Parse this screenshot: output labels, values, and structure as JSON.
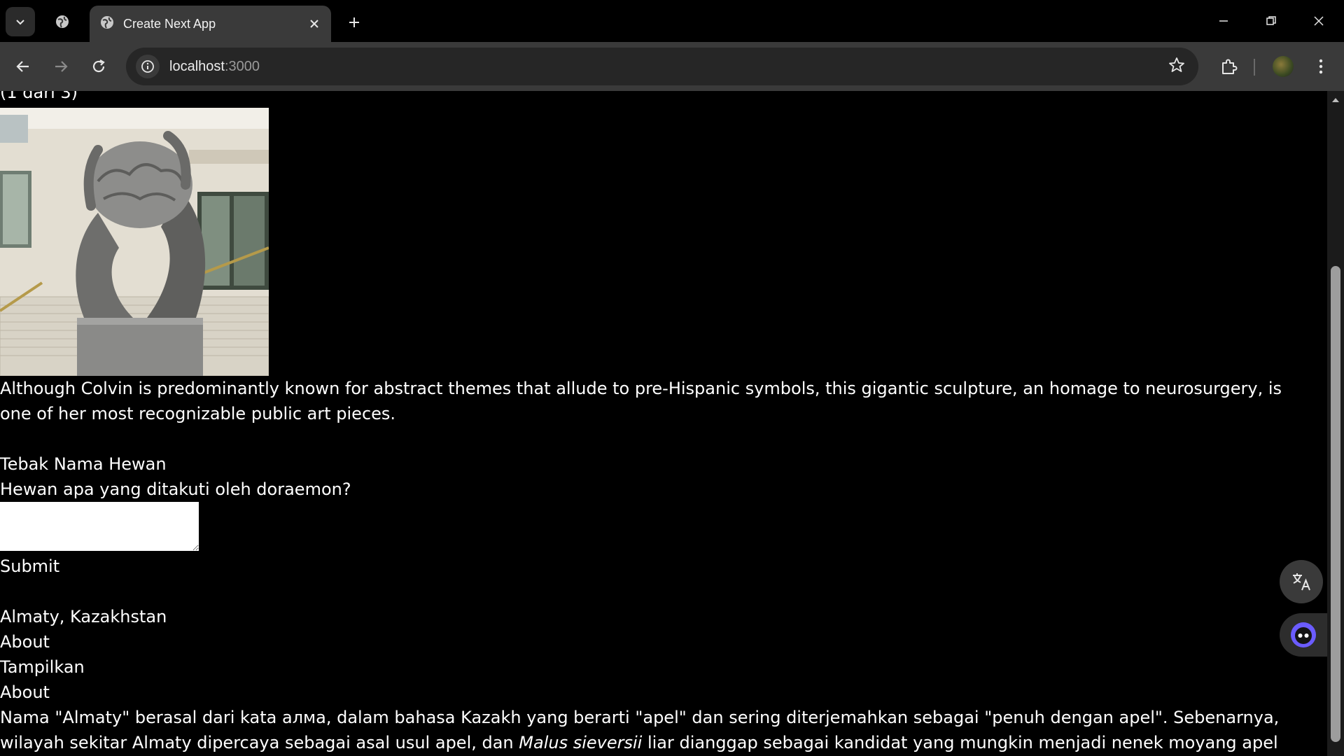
{
  "browser": {
    "tab_title": "Create Next App",
    "url_host": "localhost",
    "url_port": ":3000",
    "icons": {
      "tab_dropdown": "chevron-down-icon",
      "tab_search": "globe-icon",
      "favicon": "globe-icon",
      "tab_close": "close-icon",
      "new_tab": "plus-icon",
      "minimize": "minimize-icon",
      "restore": "restore-icon",
      "close_window": "close-icon",
      "back": "arrow-left-icon",
      "forward": "arrow-right-icon",
      "reload": "reload-icon",
      "site_info": "info-icon",
      "bookmark": "star-icon",
      "extensions": "puzzle-icon",
      "profile": "avatar",
      "menu": "kebab-menu-icon"
    }
  },
  "page": {
    "top_partial_text": "(1 dari 3)",
    "caption": "Although Colvin is predominantly known for abstract themes that allude to pre-Hispanic symbols, this gigantic sculpture, an homage to neurosurgery, is one of her most recognizable public art pieces.",
    "quiz": {
      "title": "Tebak Nama Hewan",
      "question": "Hewan apa yang ditakuti oleh doraemon?",
      "answer_value": "",
      "submit_label": "Submit"
    },
    "location": "Almaty, Kazakhstan",
    "about_label_1": "About",
    "show_label": "Tampilkan",
    "about_label_2": "About",
    "about_text_1": "Nama \"Almaty\" berasal dari kata алма, dalam bahasa Kazakh yang berarti \"apel\" dan sering diterjemahkan sebagai \"penuh dengan apel\". Sebenarnya, wilayah sekitar Almaty dipercaya sebagai asal usul apel, dan ",
    "about_text_italic": "Malus sieversii",
    "about_text_2": " liar dianggap sebagai kandidat yang mungkin menjadi nenek moyang apel domestik modern."
  },
  "colors": {
    "page_background": "#000000",
    "text": "#ffffff",
    "chrome_toolbar": "#3a3a3a",
    "omnibox": "#262626",
    "ai_button_accent": "#6b5cff"
  }
}
